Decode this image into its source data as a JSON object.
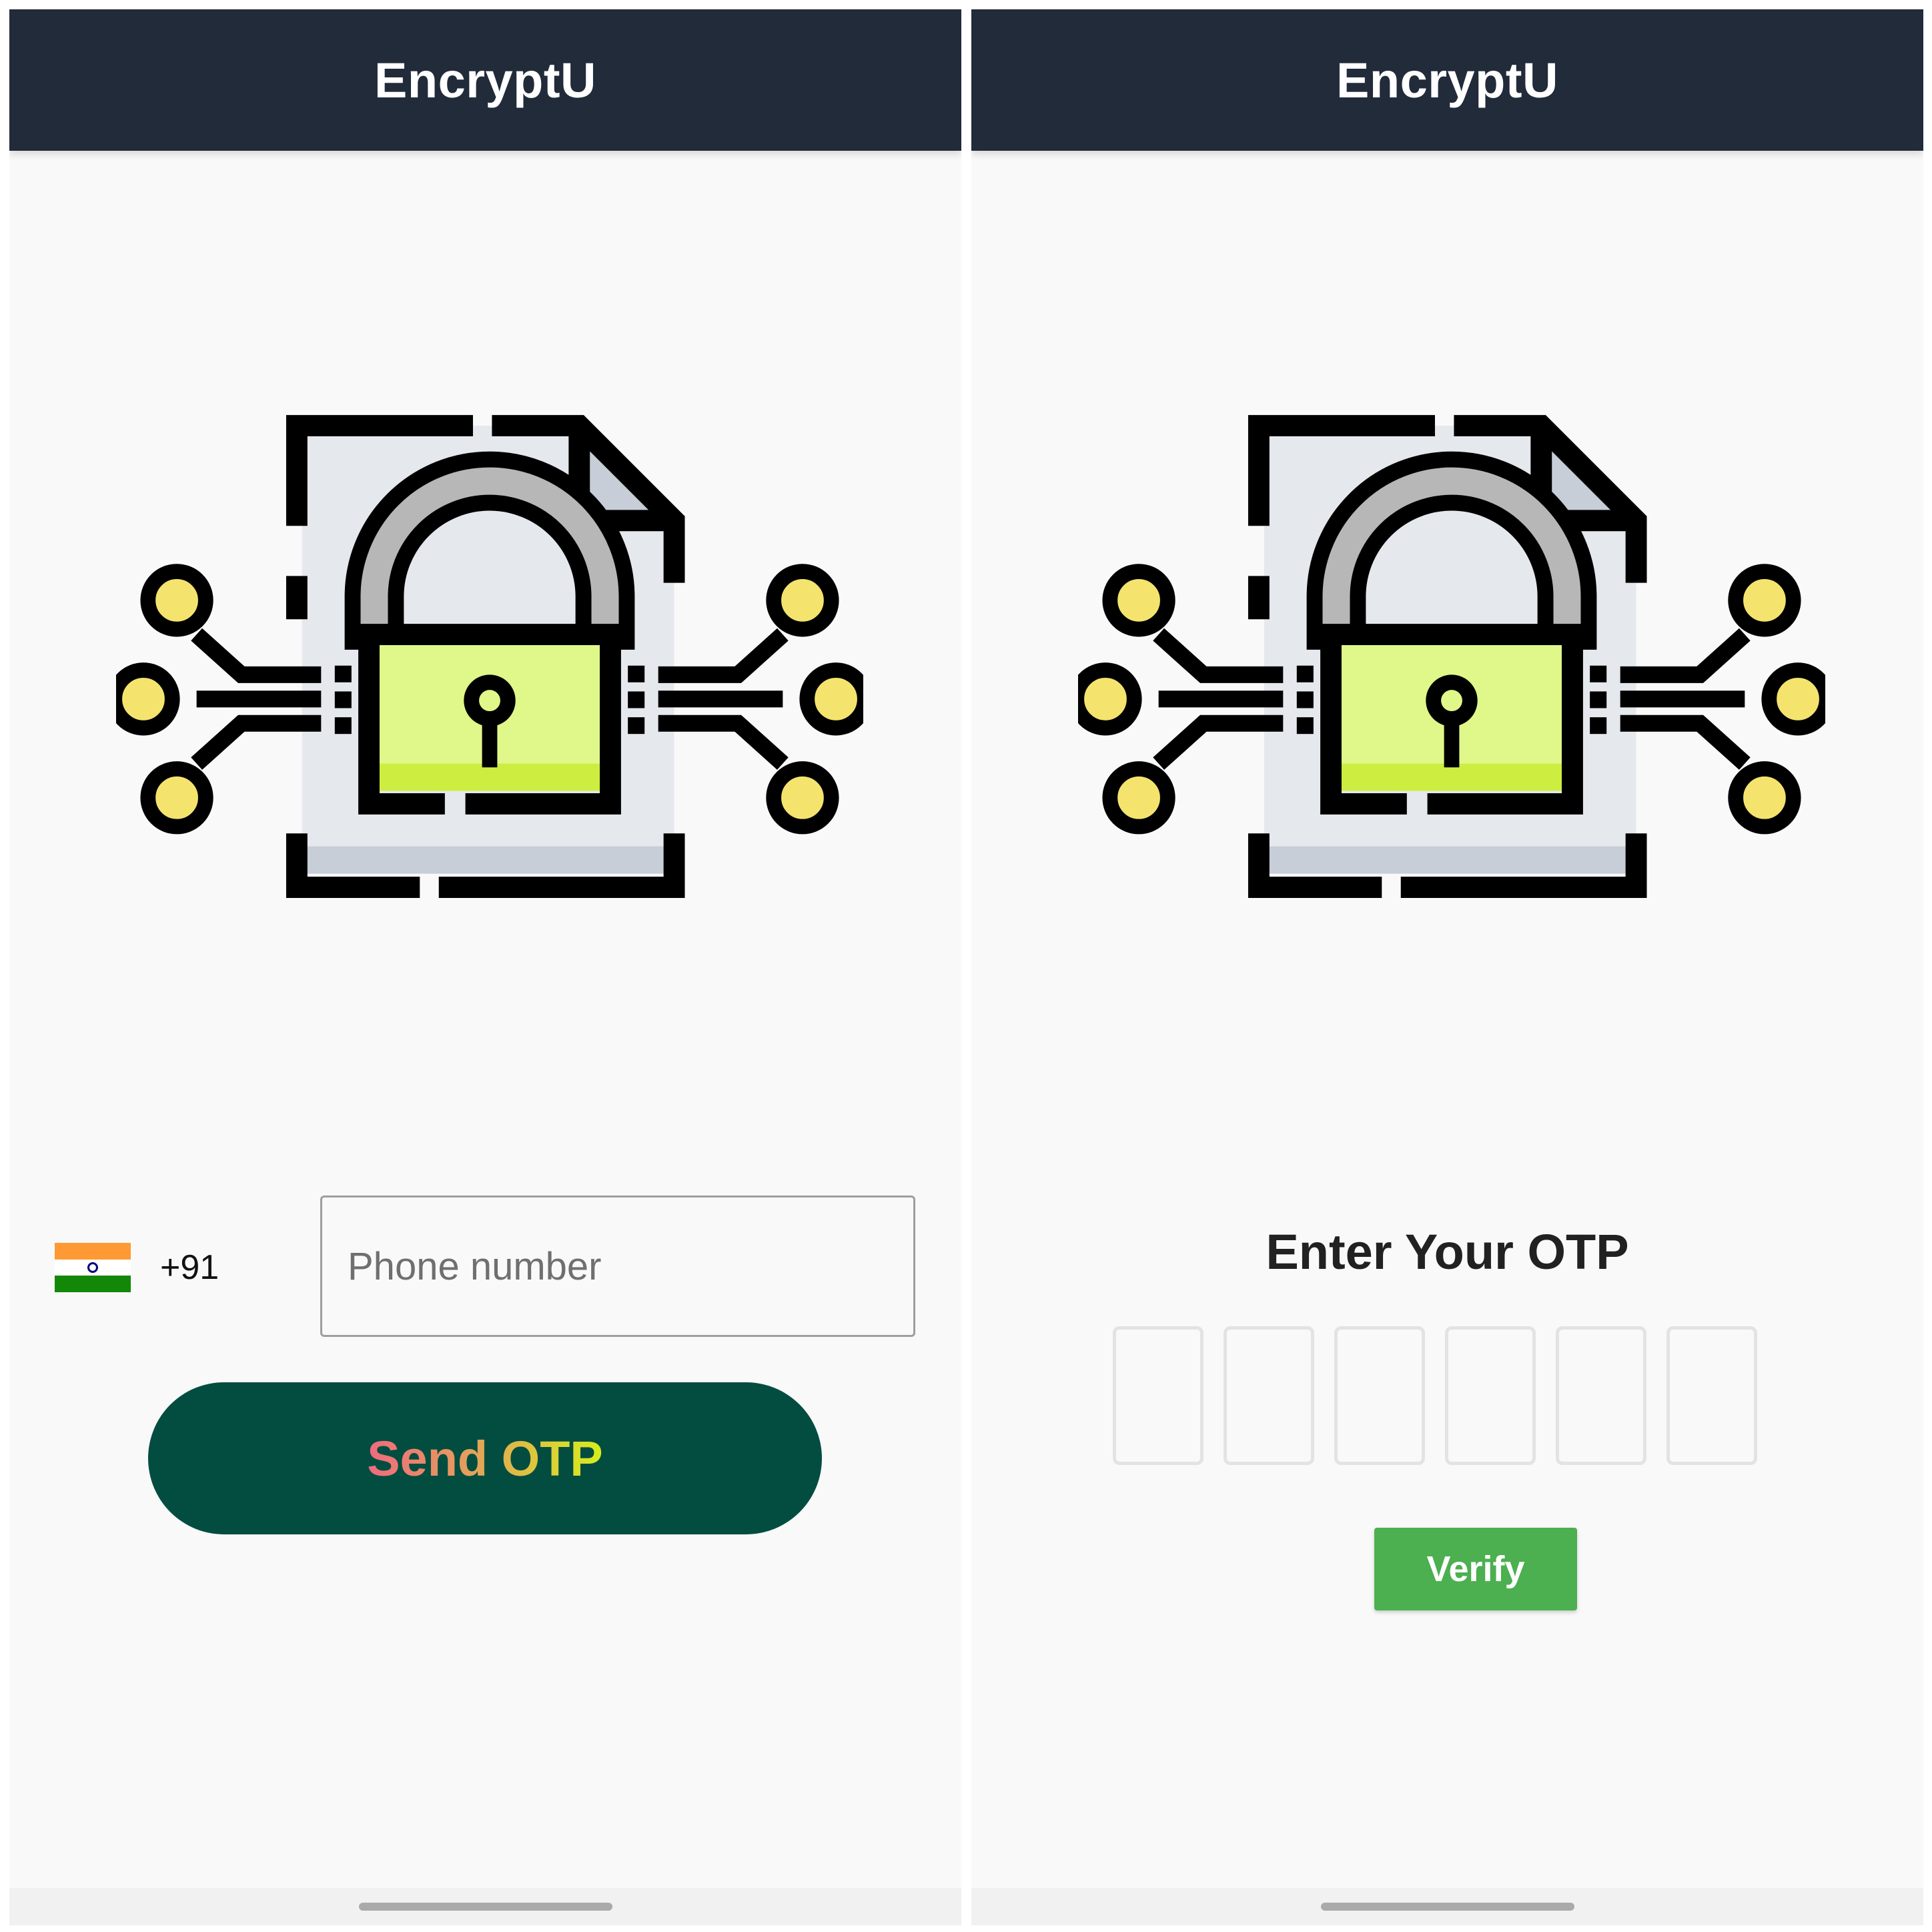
{
  "left_screen": {
    "app_title": "EncryptU",
    "country_code": "+91",
    "phone_placeholder": "Phone number",
    "send_button_label": "Send OTP"
  },
  "right_screen": {
    "app_title": "EncryptU",
    "otp_heading": "Enter Your OTP",
    "otp_digits": [
      "",
      "",
      "",
      "",
      "",
      ""
    ],
    "verify_button_label": "Verify"
  },
  "icons": {
    "illustration": "encrypted-file-lock-icon",
    "flag": "india-flag-icon"
  },
  "colors": {
    "appbar": "#212b3a",
    "send_button": "#024d40",
    "verify_button": "#4caf50",
    "lock_body": "#e0f78a",
    "node_fill": "#f4e46e",
    "document": "#e5e8ed"
  }
}
